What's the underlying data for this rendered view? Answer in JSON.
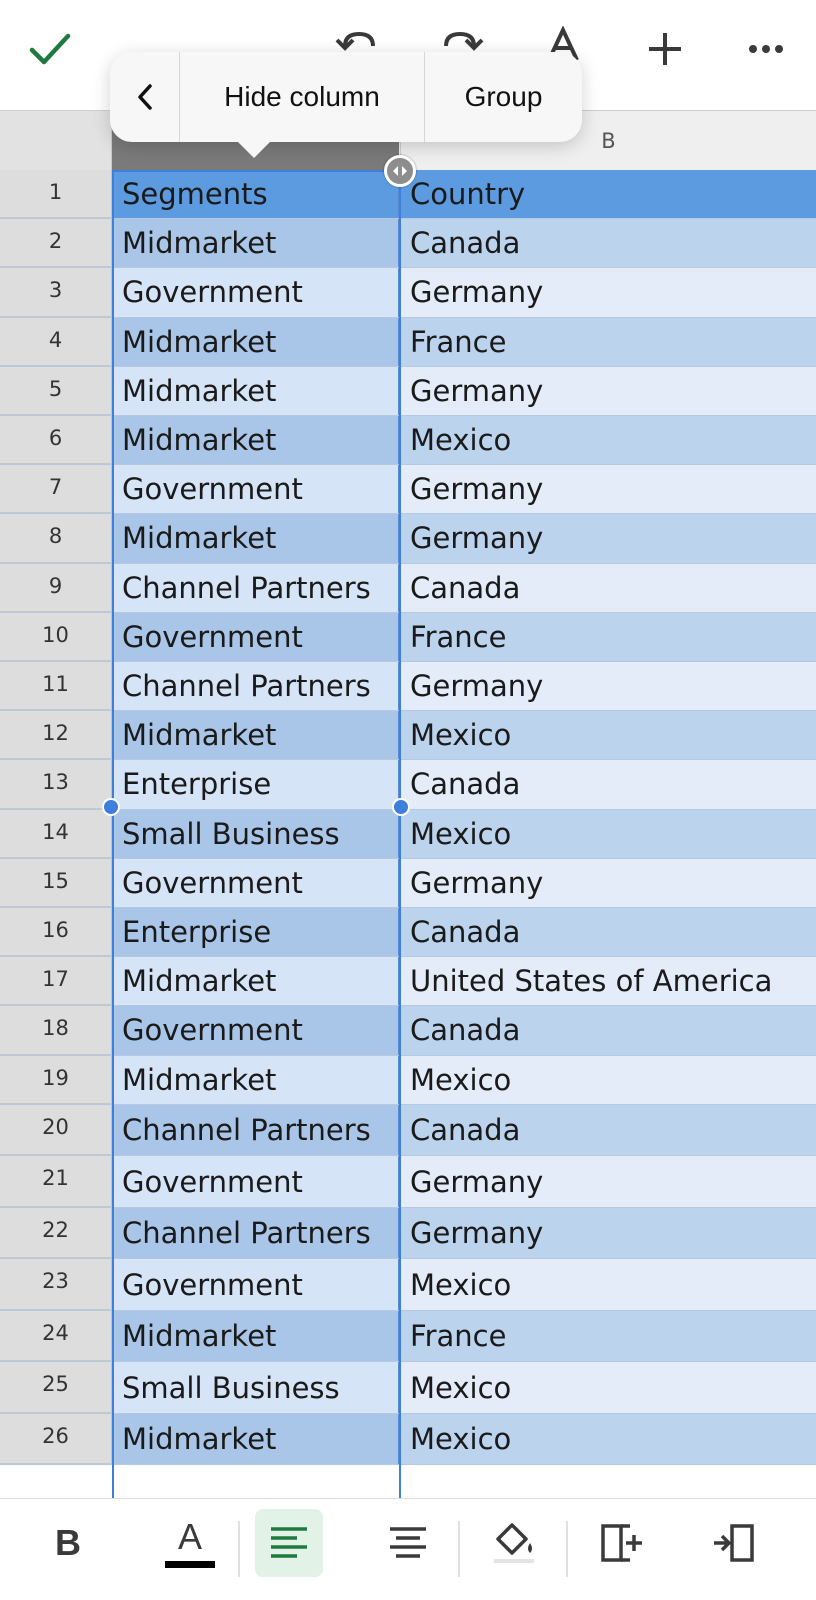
{
  "toolbar": {
    "confirm_icon": "checkmark-icon",
    "undo_icon": "undo-icon",
    "redo_icon": "redo-icon",
    "format_icon": "text-format-icon",
    "insert_icon": "plus-icon",
    "more_icon": "more-icon",
    "accent": "#1f7a3f"
  },
  "context_menu": {
    "back_icon": "chevron-left-icon",
    "items": [
      "Hide column",
      "Group"
    ]
  },
  "sheet": {
    "column_headers": [
      "",
      "B"
    ],
    "rows": [
      {
        "num": "1",
        "a": "Segments",
        "b": "Country"
      },
      {
        "num": "2",
        "a": "Midmarket",
        "b": "Canada"
      },
      {
        "num": "3",
        "a": "Government",
        "b": "Germany"
      },
      {
        "num": "4",
        "a": "Midmarket",
        "b": "France"
      },
      {
        "num": "5",
        "a": "Midmarket",
        "b": "Germany"
      },
      {
        "num": "6",
        "a": "Midmarket",
        "b": "Mexico"
      },
      {
        "num": "7",
        "a": "Government",
        "b": "Germany"
      },
      {
        "num": "8",
        "a": "Midmarket",
        "b": "Germany"
      },
      {
        "num": "9",
        "a": "Channel Partners",
        "b": "Canada"
      },
      {
        "num": "10",
        "a": "Government",
        "b": "France"
      },
      {
        "num": "11",
        "a": "Channel Partners",
        "b": "Germany"
      },
      {
        "num": "12",
        "a": "Midmarket",
        "b": "Mexico"
      },
      {
        "num": "13",
        "a": "Enterprise",
        "b": "Canada"
      },
      {
        "num": "14",
        "a": "Small Business",
        "b": "Mexico"
      },
      {
        "num": "15",
        "a": "Government",
        "b": "Germany"
      },
      {
        "num": "16",
        "a": "Enterprise",
        "b": "Canada"
      },
      {
        "num": "17",
        "a": "Midmarket",
        "b": "United States of America"
      },
      {
        "num": "18",
        "a": "Government",
        "b": "Canada"
      },
      {
        "num": "19",
        "a": "Midmarket",
        "b": "Mexico"
      },
      {
        "num": "20",
        "a": "Channel Partners",
        "b": "Canada"
      },
      {
        "num": "21",
        "a": "Government",
        "b": "Germany"
      },
      {
        "num": "22",
        "a": "Channel Partners",
        "b": "Germany"
      },
      {
        "num": "23",
        "a": "Government",
        "b": "Mexico"
      },
      {
        "num": "24",
        "a": "Midmarket",
        "b": "France"
      },
      {
        "num": "25",
        "a": "Small Business",
        "b": "Mexico"
      },
      {
        "num": "26",
        "a": "Midmarket",
        "b": "Mexico"
      }
    ],
    "colors": {
      "selected_header": "#5d9be0",
      "band_dark": "#a9c6e9",
      "band_light": "#d6e4f7",
      "selection": "#3d7fdb"
    }
  },
  "bottom_toolbar": {
    "bold_label": "B",
    "font_color_label": "A",
    "font_color_value": "#000000",
    "active_tool": "align-left",
    "icons": [
      "bold-icon",
      "font-color-icon",
      "align-left-icon",
      "align-center-icon",
      "fill-color-icon",
      "insert-column-icon",
      "column-width-icon"
    ]
  }
}
